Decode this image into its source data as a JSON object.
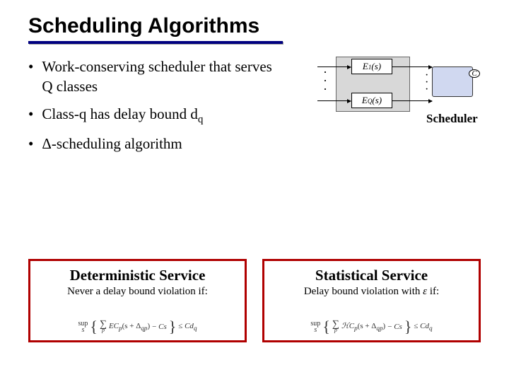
{
  "title": "Scheduling Algorithms",
  "bullets": {
    "b1": "Work-conserving scheduler that serves Q classes",
    "b2_pre": "Class-q has delay bound d",
    "b2_sub": "q",
    "b3_pre": "",
    "b3_delta": "Δ",
    "b3_post": "-scheduling algorithm"
  },
  "diagram": {
    "e1_pre": "E",
    "e1_sub": "1",
    "e1_arg": "(s)",
    "eq_pre": "E",
    "eq_sub": "Q",
    "eq_arg": "(s)",
    "c": "C",
    "scheduler": "Scheduler"
  },
  "cards": {
    "det": {
      "title": "Deterministic Service",
      "sub": "Never a delay bound violation if:"
    },
    "stat": {
      "title": "Statistical Service",
      "sub_pre": "Delay bound violation with ",
      "eps": "ε",
      "sub_post": " if:"
    }
  },
  "formula": {
    "sup": "sup",
    "sup_sub": "s",
    "sigma_sub": "p",
    "ec": "EC",
    "ec_sub": "p",
    "arg_l": "(s + Δ",
    "arg_sub": "qp",
    "arg_r": ")",
    "minus_cs": "Cs",
    "leq_cd": "Cd",
    "cd_sub": "q",
    "hc": "ℋC",
    "hc_sub": "p"
  }
}
